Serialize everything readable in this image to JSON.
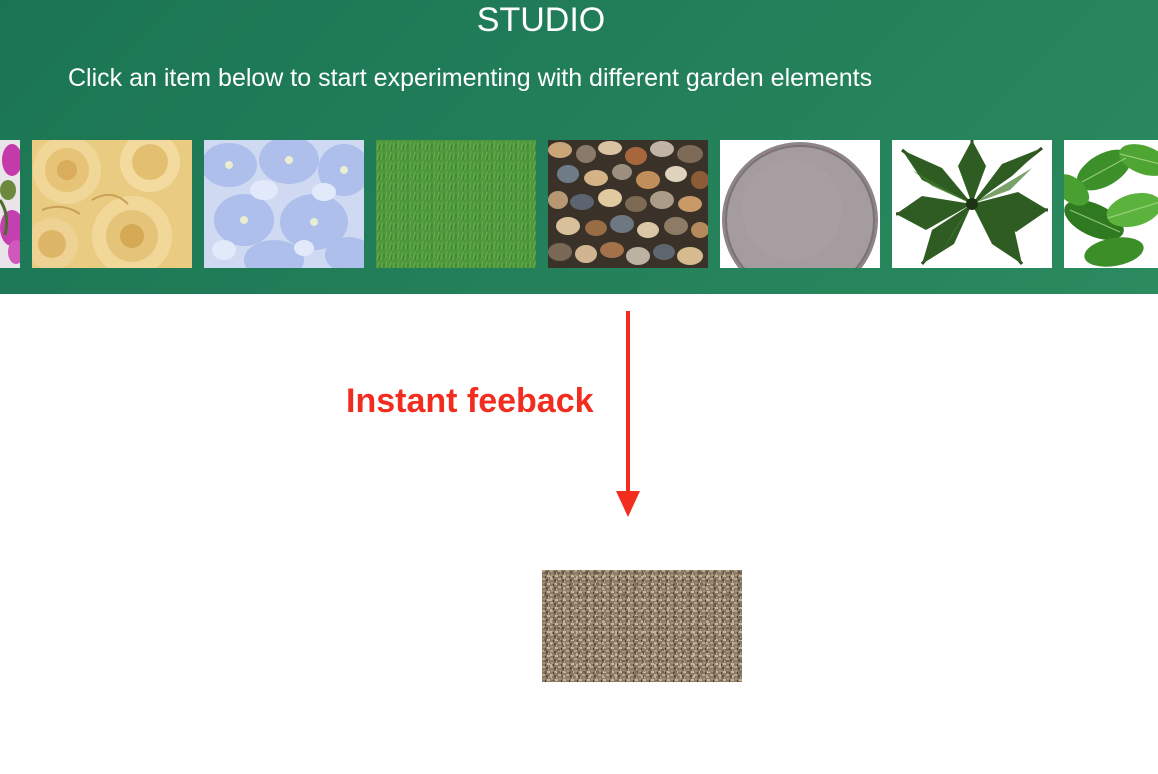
{
  "header": {
    "title": "STUDIO",
    "subtitle": "Click an item below to start experimenting with different garden elements"
  },
  "items": [
    {
      "name": "pink-orchid"
    },
    {
      "name": "yellow-roses"
    },
    {
      "name": "blue-hydrangea"
    },
    {
      "name": "grass-lawn"
    },
    {
      "name": "pebble-gravel"
    },
    {
      "name": "stone-disc"
    },
    {
      "name": "palm-fern"
    },
    {
      "name": "leafy-plant"
    }
  ],
  "annotation": {
    "label": "Instant feeback",
    "color": "#f22d1f"
  },
  "preview": {
    "material": "gravel"
  },
  "colors": {
    "header_green": "#1f7a57",
    "text": "#ffffff"
  }
}
